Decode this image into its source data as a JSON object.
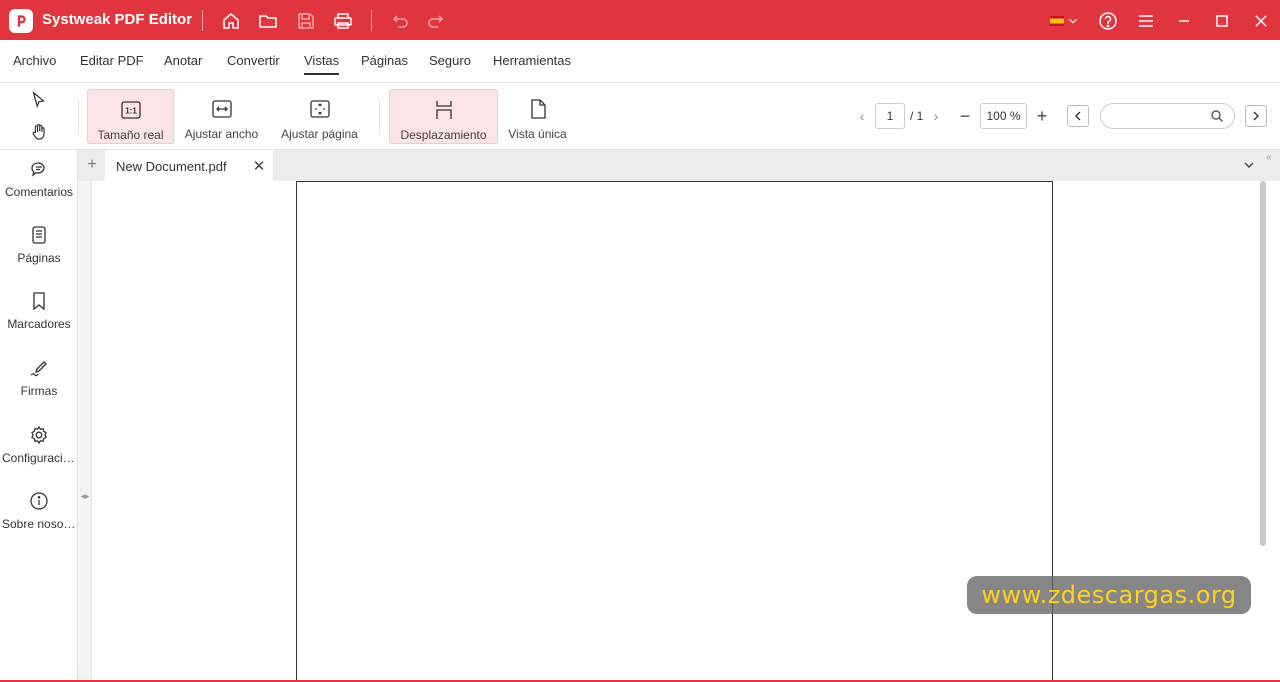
{
  "titlebar": {
    "app_title": "Systweak PDF Editor",
    "accent": "#e0343e",
    "icons": [
      "home-icon",
      "folder-icon",
      "save-icon",
      "print-icon",
      "undo-icon",
      "redo-icon",
      "flag-es-icon",
      "help-icon",
      "hamburger-icon",
      "minimize-icon",
      "maximize-icon",
      "close-icon"
    ]
  },
  "menu": {
    "items": [
      "Archivo",
      "Editar PDF",
      "Anotar",
      "Convertir",
      "Vistas",
      "Páginas",
      "Seguro",
      "Herramientas"
    ],
    "active": "Vistas"
  },
  "toolbar": {
    "tools": [
      {
        "label": "Tamaño real",
        "icon": "actual-size-icon",
        "selected": true
      },
      {
        "label": "Ajustar ancho",
        "icon": "fit-width-icon",
        "selected": false
      },
      {
        "label": "Ajustar página",
        "icon": "fit-page-icon",
        "selected": false
      },
      {
        "label": "Desplazamiento",
        "icon": "scroll-icon",
        "selected": true
      },
      {
        "label": "Vista única",
        "icon": "single-page-icon",
        "selected": false
      }
    ],
    "page_current": "1",
    "page_total": "/ 1",
    "zoom": "100 %",
    "search_placeholder": ""
  },
  "sidebar": {
    "items": [
      {
        "label": "Comentarios",
        "icon": "comments-icon"
      },
      {
        "label": "Páginas",
        "icon": "pages-icon"
      },
      {
        "label": "Marcadores",
        "icon": "bookmark-icon"
      },
      {
        "label": "Firmas",
        "icon": "signature-icon"
      },
      {
        "label": "Configuración",
        "icon": "settings-icon"
      },
      {
        "label": "Sobre nosotros",
        "icon": "info-icon"
      }
    ]
  },
  "tabs": {
    "add": "+",
    "document": "New Document.pdf",
    "close": "✕"
  },
  "watermark": "www.zdescargas.org"
}
